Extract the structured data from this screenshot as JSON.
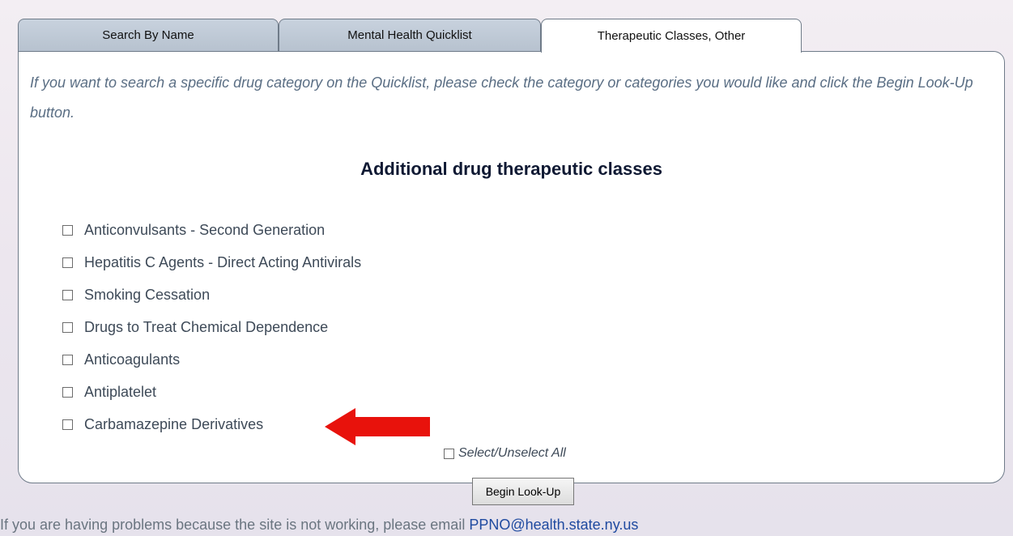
{
  "tabs": [
    {
      "label": "Search By Name"
    },
    {
      "label": "Mental Health Quicklist"
    },
    {
      "label": "Therapeutic Classes, Other"
    }
  ],
  "intro": "If you want to search a specific drug category on the Quicklist, please check the category or categories you would like and click the Begin Look-Up button.",
  "heading": "Additional drug therapeutic classes",
  "classes": [
    {
      "label": "Anticonvulsants - Second Generation",
      "checked": false
    },
    {
      "label": "Hepatitis C Agents - Direct Acting Antivirals",
      "checked": false
    },
    {
      "label": "Smoking Cessation",
      "checked": false
    },
    {
      "label": "Drugs to Treat Chemical Dependence",
      "checked": false
    },
    {
      "label": "Anticoagulants",
      "checked": false
    },
    {
      "label": "Antiplatelet",
      "checked": false
    },
    {
      "label": "Carbamazepine Derivatives",
      "checked": false
    }
  ],
  "select_all_label": "Select/Unselect All",
  "begin_button": "Begin Look-Up",
  "footer": {
    "text": "If you are having problems because the site is not working, please email ",
    "email": "PPNO@health.state.ny.us"
  },
  "colors": {
    "arrow": "#e8120c",
    "link": "#1f4aa0"
  },
  "icons": {
    "annotation": "red-arrow-icon"
  }
}
